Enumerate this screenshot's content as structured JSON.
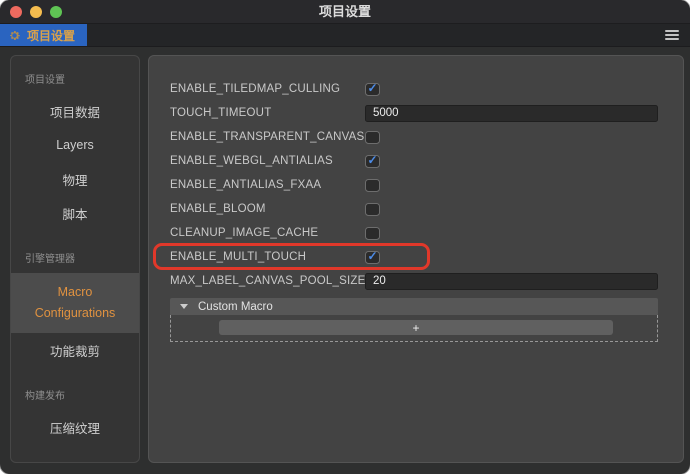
{
  "window": {
    "title": "项目设置"
  },
  "titlebar": {
    "buttons": [
      "close",
      "minimize",
      "zoom"
    ]
  },
  "tabbar": {
    "active_tab": {
      "label": "项目设置",
      "icon": "gear-icon"
    },
    "menu_icon": "hamburger-icon"
  },
  "sidebar": {
    "sections": [
      {
        "header": "项目设置",
        "items": [
          {
            "label": "项目数据",
            "selected": false
          },
          {
            "label": "Layers",
            "selected": false
          },
          {
            "label": "物理",
            "selected": false
          },
          {
            "label": "脚本",
            "selected": false
          }
        ]
      },
      {
        "header": "引擎管理器",
        "items": [
          {
            "label": "Macro Configurations",
            "selected": true
          },
          {
            "label": "功能裁剪",
            "selected": false
          }
        ]
      },
      {
        "header": "构建发布",
        "items": [
          {
            "label": "压缩纹理",
            "selected": false
          }
        ]
      }
    ]
  },
  "settings": {
    "rows": [
      {
        "label": "ENABLE_TILEDMAP_CULLING",
        "type": "checkbox",
        "checked": true
      },
      {
        "label": "TOUCH_TIMEOUT",
        "type": "input",
        "value": "5000"
      },
      {
        "label": "ENABLE_TRANSPARENT_CANVAS",
        "type": "checkbox",
        "checked": false
      },
      {
        "label": "ENABLE_WEBGL_ANTIALIAS",
        "type": "checkbox",
        "checked": true
      },
      {
        "label": "ENABLE_ANTIALIAS_FXAA",
        "type": "checkbox",
        "checked": false
      },
      {
        "label": "ENABLE_BLOOM",
        "type": "checkbox",
        "checked": false
      },
      {
        "label": "CLEANUP_IMAGE_CACHE",
        "type": "checkbox",
        "checked": false
      },
      {
        "label": "ENABLE_MULTI_TOUCH",
        "type": "checkbox",
        "checked": true,
        "highlighted": true
      },
      {
        "label": "MAX_LABEL_CANVAS_POOL_SIZE",
        "type": "input",
        "value": "20"
      }
    ],
    "custom_macro": {
      "header": "Custom Macro",
      "collapsed": false,
      "add_button_label": "+"
    }
  },
  "colors": {
    "accent_blue": "#2a64c0",
    "tab_text_orange": "#daa24a",
    "selected_item_orange": "#e09240",
    "checkbox_check_blue": "#4d8ce8",
    "highlight_red": "#e1382a"
  }
}
